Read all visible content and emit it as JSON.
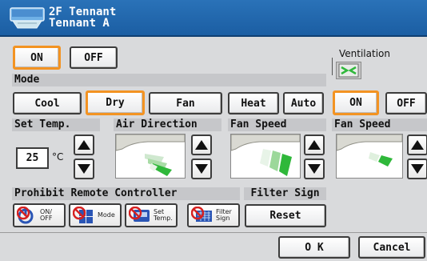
{
  "header": {
    "line1": "2F Tennant",
    "line2": "Tennant A",
    "icon": "air-conditioner-icon"
  },
  "power": {
    "on": "ON",
    "off": "OFF",
    "selected": "ON"
  },
  "mode": {
    "label": "Mode",
    "options": [
      "Cool",
      "Dry",
      "Fan",
      "Heat",
      "Auto"
    ],
    "selected": "Dry"
  },
  "set_temp": {
    "label": "Set Temp.",
    "value": "25",
    "unit": "°C"
  },
  "air_direction": {
    "label": "Air Direction"
  },
  "fan_speed": {
    "label": "Fan Speed"
  },
  "ventilation": {
    "label": "Ventilation",
    "on": "ON",
    "off": "OFF",
    "selected": "ON",
    "fan_speed_label": "Fan Speed",
    "icon": "ventilation-icon"
  },
  "prohibit": {
    "label": "Prohibit Remote Controller",
    "buttons": [
      {
        "line1": "ON/",
        "line2": "OFF",
        "icon": "power-prohibit-icon"
      },
      {
        "line1": "Mode",
        "line2": "",
        "icon": "mode-prohibit-icon"
      },
      {
        "line1": "Set",
        "line2": "Temp.",
        "icon": "temp-prohibit-icon"
      },
      {
        "line1": "Filter",
        "line2": "Sign",
        "icon": "filter-prohibit-icon"
      }
    ]
  },
  "filter_sign": {
    "label": "Filter Sign",
    "reset": "Reset"
  },
  "footer": {
    "ok": "O K",
    "cancel": "Cancel"
  },
  "colors": {
    "title_bar": "#1b5ea3",
    "selected_outline": "#f39322",
    "background": "#d9dadc",
    "fan_green": "#2fb83a"
  }
}
